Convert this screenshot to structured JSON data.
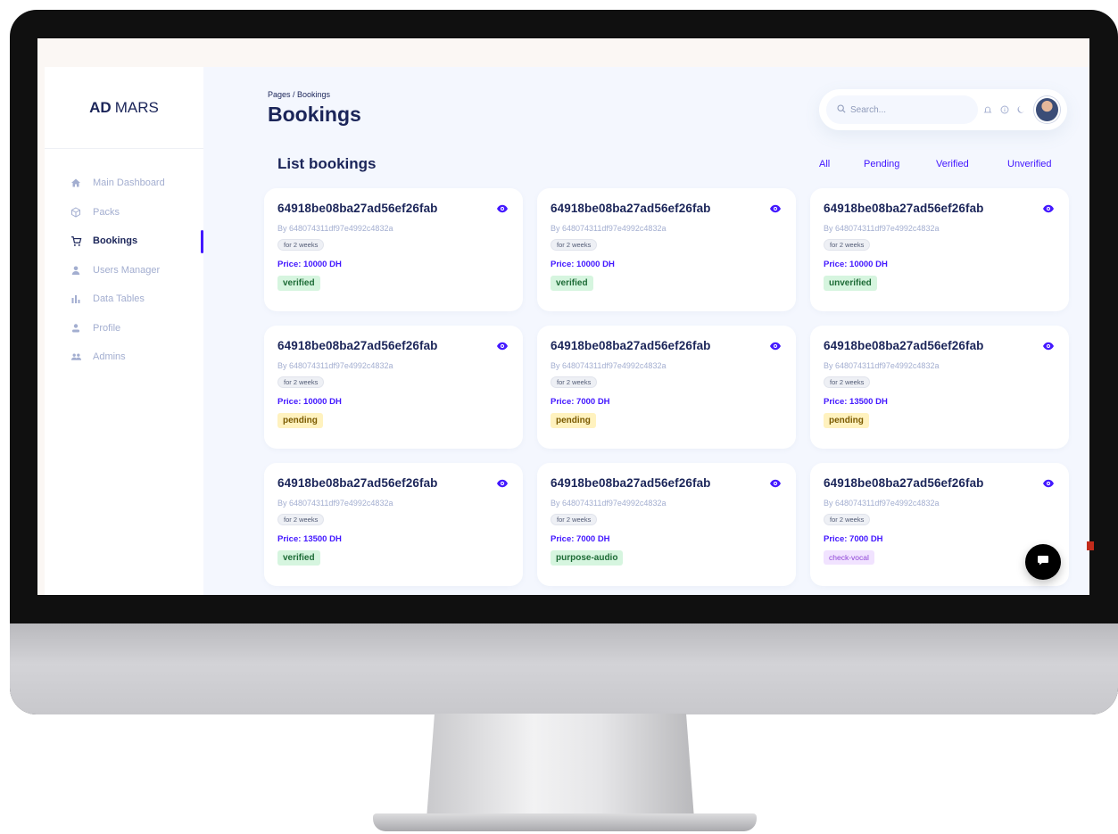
{
  "brand": {
    "bold": "AD",
    "rest": "MARS"
  },
  "sidebar": {
    "items": [
      {
        "label": "Main Dashboard",
        "icon": "home-icon",
        "active": false
      },
      {
        "label": "Packs",
        "icon": "cube-icon",
        "active": false
      },
      {
        "label": "Bookings",
        "icon": "cart-icon",
        "active": true
      },
      {
        "label": "Users Manager",
        "icon": "user-icon",
        "active": false
      },
      {
        "label": "Data Tables",
        "icon": "bar-chart-icon",
        "active": false
      },
      {
        "label": "Profile",
        "icon": "person-icon",
        "active": false
      },
      {
        "label": "Admins",
        "icon": "group-icon",
        "active": false
      }
    ]
  },
  "header": {
    "breadcrumb": "Pages / Bookings",
    "title": "Bookings",
    "search_placeholder": "Search...",
    "icons": [
      "bell-icon",
      "info-icon",
      "moon-icon"
    ]
  },
  "list": {
    "title": "List bookings",
    "filters": [
      "All",
      "Pending",
      "Verified",
      "Unverified"
    ]
  },
  "bookings": [
    {
      "id": "64918be08ba27ad56ef26fab",
      "by": "By 648074311df97e4992c4832a",
      "duration": "for 2 weeks",
      "price": "Price: 10000 DH",
      "status": "verified",
      "status_style": "verified"
    },
    {
      "id": "64918be08ba27ad56ef26fab",
      "by": "By 648074311df97e4992c4832a",
      "duration": "for 2 weeks",
      "price": "Price: 10000 DH",
      "status": "verified",
      "status_style": "verified"
    },
    {
      "id": "64918be08ba27ad56ef26fab",
      "by": "By 648074311df97e4992c4832a",
      "duration": "for 2 weeks",
      "price": "Price: 10000 DH",
      "status": "unverified",
      "status_style": "unverified"
    },
    {
      "id": "64918be08ba27ad56ef26fab",
      "by": "By 648074311df97e4992c4832a",
      "duration": "for 2 weeks",
      "price": "Price: 10000 DH",
      "status": "pending",
      "status_style": "pending"
    },
    {
      "id": "64918be08ba27ad56ef26fab",
      "by": "By 648074311df97e4992c4832a",
      "duration": "for 2 weeks",
      "price": "Price: 7000 DH",
      "status": "pending",
      "status_style": "pending"
    },
    {
      "id": "64918be08ba27ad56ef26fab",
      "by": "By 648074311df97e4992c4832a",
      "duration": "for 2 weeks",
      "price": "Price: 13500 DH",
      "status": "pending",
      "status_style": "pending"
    },
    {
      "id": "64918be08ba27ad56ef26fab",
      "by": "By 648074311df97e4992c4832a",
      "duration": "for 2 weeks",
      "price": "Price: 13500 DH",
      "status": "verified",
      "status_style": "verified"
    },
    {
      "id": "64918be08ba27ad56ef26fab",
      "by": "By 648074311df97e4992c4832a",
      "duration": "for 2 weeks",
      "price": "Price: 7000 DH",
      "status": "purpose-audio",
      "status_style": "audio"
    },
    {
      "id": "64918be08ba27ad56ef26fab",
      "by": "By 648074311df97e4992c4832a",
      "duration": "for 2 weeks",
      "price": "Price: 7000 DH",
      "status": "check-vocal",
      "status_style": "vocal"
    }
  ],
  "colors": {
    "accent": "#4318ff",
    "navy": "#1b2559",
    "muted": "#a3aed0",
    "background": "#f4f7fe"
  }
}
